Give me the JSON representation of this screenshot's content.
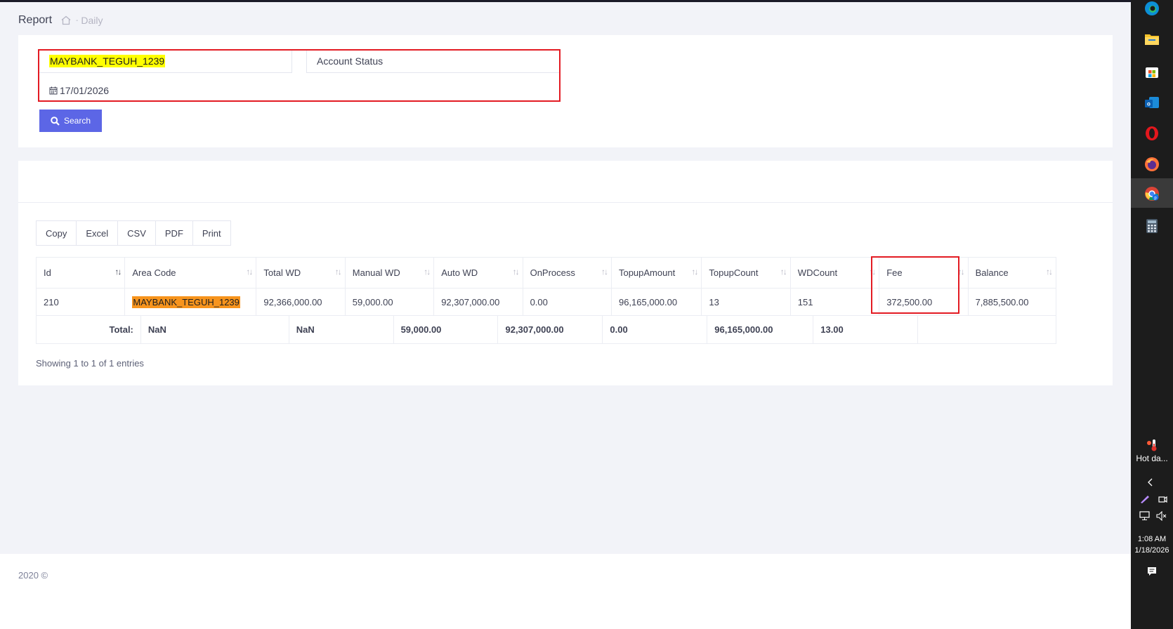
{
  "header": {
    "title": "Report",
    "separator": "-",
    "breadcrumb": "Daily"
  },
  "filters": {
    "account": "MAYBANK_TEGUH_1239",
    "account_status_placeholder": "Account Status",
    "date": "17/01/2026",
    "search_label": "Search"
  },
  "export_buttons": [
    "Copy",
    "Excel",
    "CSV",
    "PDF",
    "Print"
  ],
  "table": {
    "columns": [
      "Id",
      "Area Code",
      "Total WD",
      "Manual WD",
      "Auto WD",
      "OnProcess",
      "TopupAmount",
      "TopupCount",
      "WDCount",
      "Fee",
      "Balance"
    ],
    "rows": [
      [
        "210",
        "MAYBANK_TEGUH_1239",
        "92,366,000.00",
        "59,000.00",
        "92,307,000.00",
        "0.00",
        "96,165,000.00",
        "13",
        "151",
        "372,500.00",
        "7,885,500.00"
      ]
    ],
    "totals": {
      "label": "Total:",
      "values": [
        "NaN",
        "NaN",
        "59,000.00",
        "92,307,000.00",
        "0.00",
        "96,165,000.00",
        "13.00",
        ""
      ]
    },
    "info": "Showing 1 to 1 of 1 entries"
  },
  "footer": {
    "text": "2020 ©"
  },
  "taskbar": {
    "weather_text": "Hot da...",
    "time": "1:08 AM",
    "date": "1/18/2026"
  },
  "colors": {
    "accent": "#5c66e6",
    "highlight_yellow": "#ffff00",
    "highlight_orange": "#f7941d",
    "annotation_red": "#e31b23"
  }
}
